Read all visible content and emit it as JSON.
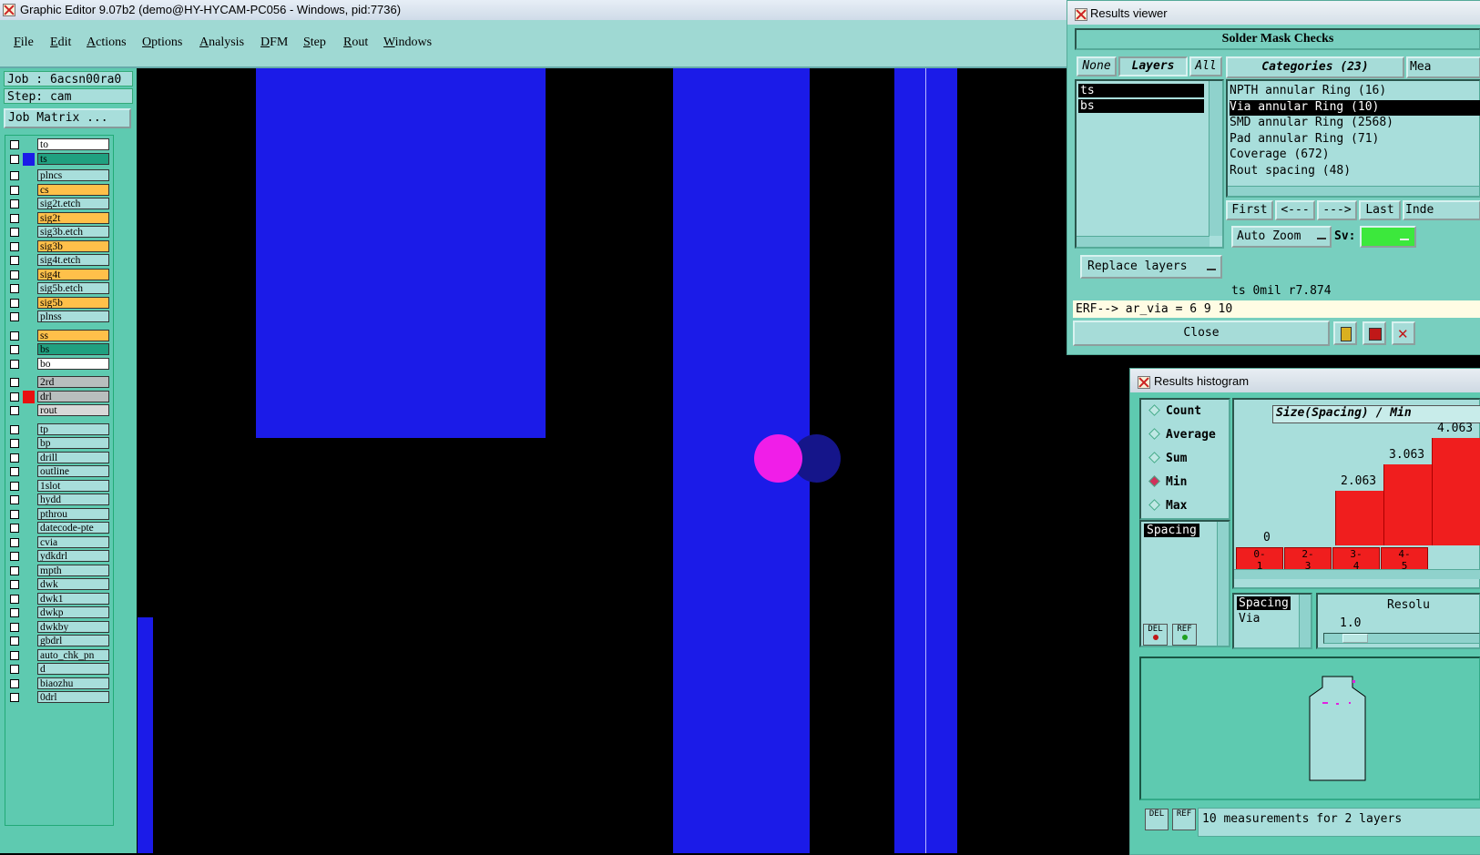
{
  "window": {
    "title": "Graphic Editor 9.07b2 (demo@HY-HYCAM-PC056 - Windows, pid:7736)"
  },
  "menu": [
    "File",
    "Edit",
    "Actions",
    "Options",
    "Analysis",
    "DFM",
    "Step",
    "Rout",
    "Windows"
  ],
  "job": {
    "job_label": "Job : 6acsn00ra0",
    "step_label": "Step: cam",
    "matrix_button": "Job Matrix ..."
  },
  "layers": [
    {
      "name": "to",
      "color": "#ffffff"
    },
    {
      "name": "ts",
      "color": "#20a080",
      "active": true
    },
    {
      "name": "plncs",
      "color": "#a8dedb"
    },
    {
      "name": "cs",
      "color": "#ffc04a"
    },
    {
      "name": "sig2t.etch",
      "color": "#a8dedb"
    },
    {
      "name": "sig2t",
      "color": "#ffc04a"
    },
    {
      "name": "sig3b.etch",
      "color": "#a8dedb"
    },
    {
      "name": "sig3b",
      "color": "#ffc04a"
    },
    {
      "name": "sig4t.etch",
      "color": "#a8dedb"
    },
    {
      "name": "sig4t",
      "color": "#ffc04a"
    },
    {
      "name": "sig5b.etch",
      "color": "#a8dedb"
    },
    {
      "name": "sig5b",
      "color": "#ffc04a"
    },
    {
      "name": "plnss",
      "color": "#a8dedb"
    },
    {
      "name": "ss",
      "color": "#ffc04a"
    },
    {
      "name": "bs",
      "color": "#20a080"
    },
    {
      "name": "bo",
      "color": "#ffffff"
    },
    {
      "name": "2rd",
      "color": "#b8bebe"
    },
    {
      "name": "drl",
      "color": "#b8bebe",
      "marker": "#e81010"
    },
    {
      "name": "rout",
      "color": "#d8d8d8"
    },
    {
      "name": "tp",
      "color": "#a8dedb"
    },
    {
      "name": "bp",
      "color": "#a8dedb"
    },
    {
      "name": "drill",
      "color": "#a8dedb"
    },
    {
      "name": "outline",
      "color": "#a8dedb"
    },
    {
      "name": "1slot",
      "color": "#a8dedb"
    },
    {
      "name": "hydd",
      "color": "#a8dedb"
    },
    {
      "name": "pthrou",
      "color": "#a8dedb"
    },
    {
      "name": "datecode-pte",
      "color": "#a8dedb"
    },
    {
      "name": "cvia",
      "color": "#a8dedb"
    },
    {
      "name": "ydkdrl",
      "color": "#a8dedb"
    },
    {
      "name": "mpth",
      "color": "#a8dedb"
    },
    {
      "name": "dwk",
      "color": "#a8dedb"
    },
    {
      "name": "dwk1",
      "color": "#a8dedb"
    },
    {
      "name": "dwkp",
      "color": "#a8dedb"
    },
    {
      "name": "dwkby",
      "color": "#a8dedb"
    },
    {
      "name": "gbdrl",
      "color": "#a8dedb"
    },
    {
      "name": "auto_chk_pn",
      "color": "#a8dedb"
    },
    {
      "name": "d",
      "color": "#a8dedb"
    },
    {
      "name": "biaozhu",
      "color": "#a8dedb"
    },
    {
      "name": "0drl",
      "color": "#a8dedb"
    }
  ],
  "results_viewer": {
    "title": "Results viewer",
    "header": "Solder Mask Checks",
    "tab_none": "None",
    "tab_layers": "Layers",
    "tab_all": "All",
    "categories_label": "Categories (23)",
    "meas_tab": "Mea",
    "layer_items": [
      "ts",
      "bs"
    ],
    "categories": [
      "NPTH annular Ring (16)",
      "Via annular Ring (10)",
      "SMD annular Ring (2568)",
      "Pad annular Ring (71)",
      "Coverage (672)",
      "Rout spacing (48)"
    ],
    "selected_category_index": 1,
    "nav_first": "First",
    "nav_prev": "<---",
    "nav_next": "--->",
    "nav_last": "Last",
    "nav_index": "Inde",
    "auto_zoom": "Auto Zoom",
    "sv_label": "Sv:",
    "sv_color": "#3ce83c",
    "replace_layers": "Replace layers",
    "status_line": "ts 0mil  r7.874",
    "erf_line": "ERF--> ar_via = 6 9 10",
    "close_label": "Close"
  },
  "histogram": {
    "title": "Results histogram",
    "chart_title": "Size(Spacing) / Min",
    "modes": [
      "Count",
      "Average",
      "Sum",
      "Min",
      "Max"
    ],
    "selected_mode": "Min",
    "left_list": [
      "Spacing"
    ],
    "bars": [
      {
        "bin": "0-1",
        "value": 0,
        "label": "0"
      },
      {
        "bin": "2-3",
        "value": 2.063,
        "label": "2.063"
      },
      {
        "bin": "3-4",
        "value": 3.063,
        "label": "3.063"
      },
      {
        "bin": "4-5",
        "value": 4.063,
        "label": "4.063"
      }
    ],
    "lower_list": [
      "Spacing",
      "Via"
    ],
    "resolution_label": "Resolu",
    "resolution_value": "1.0",
    "del_label": "DEL",
    "ref_label": "REF",
    "footer_text": "10 measurements for 2 layers"
  }
}
